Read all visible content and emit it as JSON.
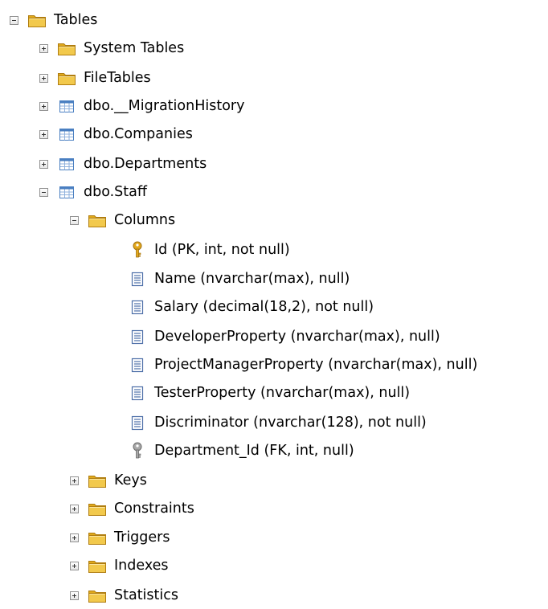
{
  "tree": {
    "root": {
      "label": "Tables",
      "expanded": true
    },
    "children": [
      {
        "label": "System Tables",
        "icon": "folder-icon",
        "expanded": false
      },
      {
        "label": "FileTables",
        "icon": "folder-icon",
        "expanded": false
      },
      {
        "label": "dbo.__MigrationHistory",
        "icon": "table-icon",
        "expanded": false
      },
      {
        "label": "dbo.Companies",
        "icon": "table-icon",
        "expanded": false
      },
      {
        "label": "dbo.Departments",
        "icon": "table-icon",
        "expanded": false
      },
      {
        "label": "dbo.Staff",
        "icon": "table-icon",
        "expanded": true
      }
    ],
    "staff": {
      "columns_folder": {
        "label": "Columns",
        "expanded": true
      },
      "columns": [
        {
          "label": "Id (PK, int, not null)",
          "icon": "primary-key-icon"
        },
        {
          "label": "Name (nvarchar(max), null)",
          "icon": "column-icon"
        },
        {
          "label": "Salary (decimal(18,2), not null)",
          "icon": "column-icon"
        },
        {
          "label": "DeveloperProperty (nvarchar(max), null)",
          "icon": "column-icon"
        },
        {
          "label": "ProjectManagerProperty (nvarchar(max), null)",
          "icon": "column-icon"
        },
        {
          "label": "TesterProperty (nvarchar(max), null)",
          "icon": "column-icon"
        },
        {
          "label": "Discriminator (nvarchar(128), not null)",
          "icon": "column-icon"
        },
        {
          "label": "Department_Id (FK, int, null)",
          "icon": "foreign-key-icon"
        }
      ],
      "folders": [
        {
          "label": "Keys",
          "expanded": false
        },
        {
          "label": "Constraints",
          "expanded": false
        },
        {
          "label": "Triggers",
          "expanded": false
        },
        {
          "label": "Indexes",
          "expanded": false
        },
        {
          "label": "Statistics",
          "expanded": false
        }
      ]
    }
  },
  "colors": {
    "folder_body": "#f2c94c",
    "folder_tab": "#e0a91b",
    "table_blue": "#4a7fc1",
    "key_gold": "#e3a81b",
    "key_gray": "#8e8e8e"
  }
}
